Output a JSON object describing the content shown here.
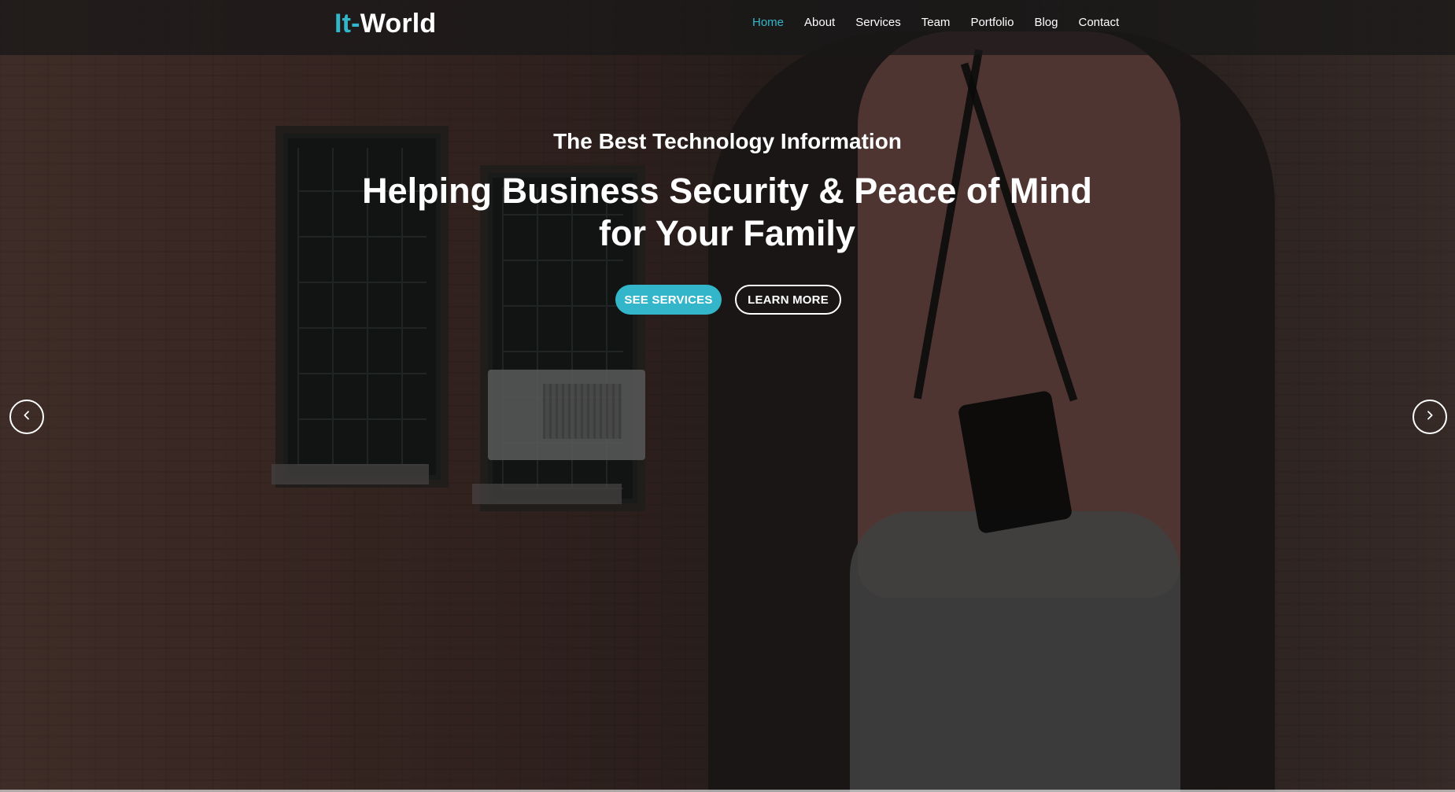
{
  "header": {
    "brand": {
      "prefix": "It-",
      "name": "World"
    },
    "nav": [
      {
        "label": "Home",
        "active": true
      },
      {
        "label": "About",
        "active": false
      },
      {
        "label": "Services",
        "active": false
      },
      {
        "label": "Team",
        "active": false
      },
      {
        "label": "Portfolio",
        "active": false
      },
      {
        "label": "Blog",
        "active": false
      },
      {
        "label": "Contact",
        "active": false
      }
    ]
  },
  "hero": {
    "subtitle": "The Best Technology Information",
    "title": "Helping Business Security & Peace of Mind for Your Family",
    "buttons": {
      "primary": "SEE SERVICES",
      "secondary": "LEARN MORE"
    }
  },
  "icons": {
    "prev": "chevron-left-icon",
    "next": "chevron-right-icon"
  },
  "colors": {
    "accent": "#33b6c9",
    "header_bg": "#171717",
    "text": "#ffffff"
  }
}
